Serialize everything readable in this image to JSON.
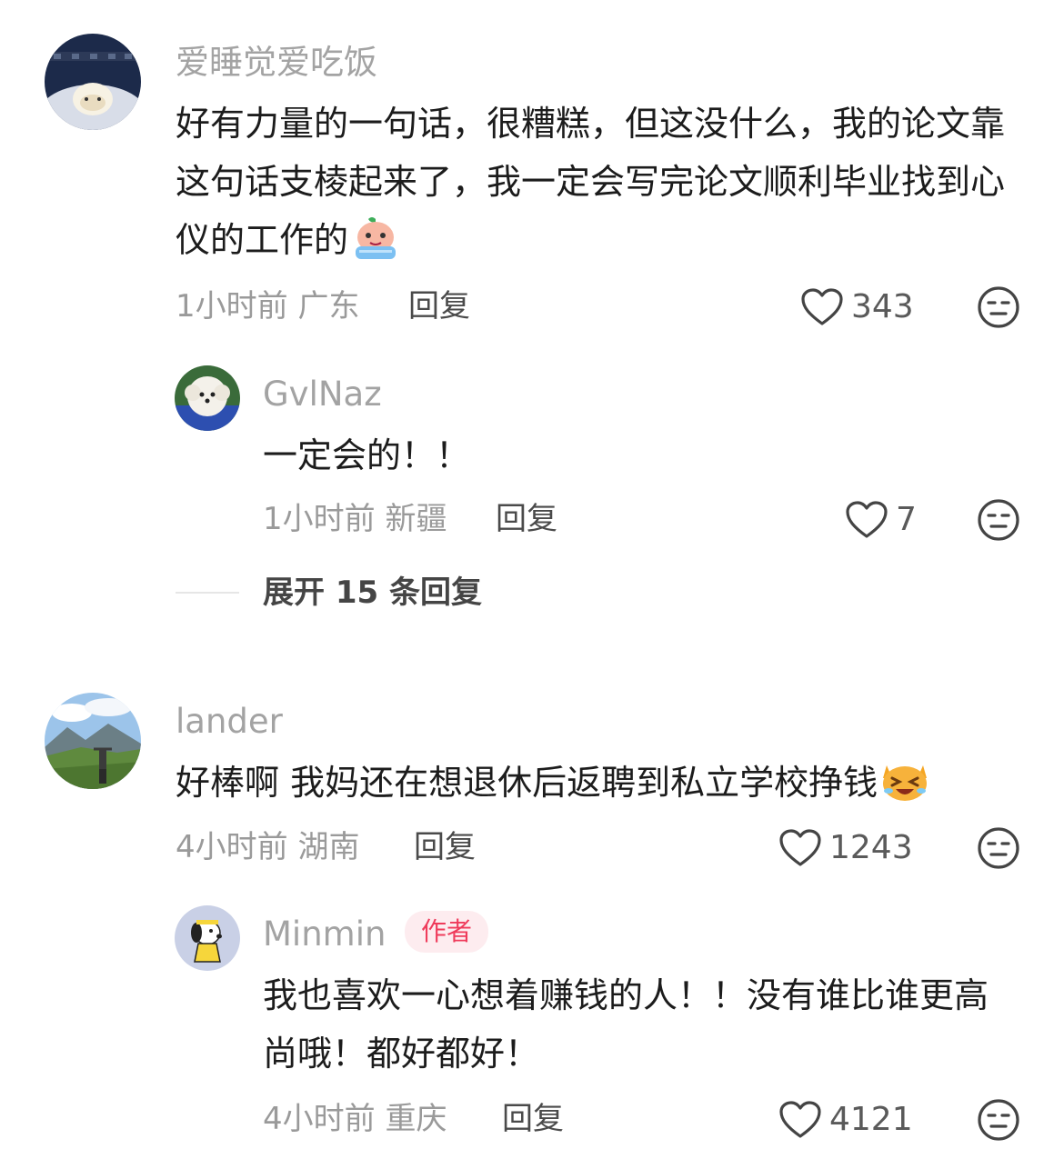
{
  "comments": [
    {
      "avatar": "avatar-night-cat",
      "username": "爱睡觉爱吃饭",
      "content": "好有力量的一句话，很糟糕，但这没什么，我的论文靠这句话支棱起来了，我一定会写完论文顺利毕业找到心仪的工作的",
      "emoji": "crying-peach-emoji",
      "time": "1小时前",
      "location": "广东",
      "reply_label": "回复",
      "likes": "343",
      "replies": [
        {
          "avatar": "avatar-white-dog",
          "username": "GvlNaz",
          "content": "一定会的！！",
          "time": "1小时前",
          "location": "新疆",
          "reply_label": "回复",
          "likes": "7"
        }
      ],
      "expand_label": "展开 15 条回复"
    },
    {
      "avatar": "avatar-mountain",
      "username": "lander",
      "content": "好棒啊 我妈还在想退休后返聘到私立学校挣钱",
      "emoji": "laughing-cat-emoji",
      "time": "4小时前",
      "location": "湖南",
      "reply_label": "回复",
      "likes": "1243",
      "replies": [
        {
          "avatar": "avatar-snoopy",
          "username": "Minmin",
          "badge": "作者",
          "content": "我也喜欢一心想着赚钱的人！！没有谁比谁更高尚哦！都好都好！",
          "time": "4小时前",
          "location": "重庆",
          "reply_label": "回复",
          "likes": "4121"
        }
      ]
    }
  ],
  "colors": {
    "username": "#a3a3a3",
    "meta": "#9a9a9a",
    "badge_bg": "#fdecef",
    "badge_text": "#ef3b5b",
    "icon": "#444444"
  },
  "icons": {
    "like": "heart-outline-icon",
    "dislike": "neutral-face-icon"
  }
}
